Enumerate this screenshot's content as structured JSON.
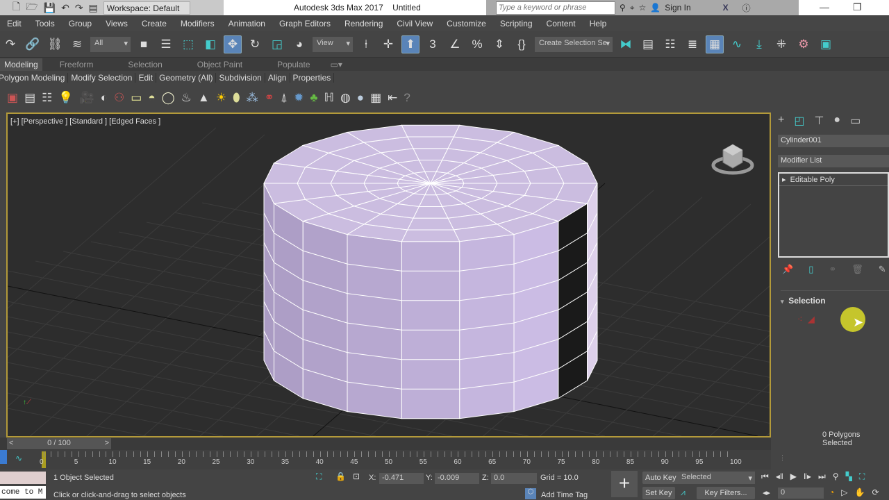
{
  "titlebar": {
    "workspace": "Workspace: Default",
    "app_title": "Autodesk 3ds Max 2017",
    "doc_title": "Untitled",
    "search_placeholder": "Type a keyword or phrase",
    "sign_in": "Sign In"
  },
  "menu": [
    "Edit",
    "Tools",
    "Group",
    "Views",
    "Create",
    "Modifiers",
    "Animation",
    "Graph Editors",
    "Rendering",
    "Civil View",
    "Customize",
    "Scripting",
    "Content",
    "Help"
  ],
  "toolbar": {
    "filter": "All",
    "ref_coord": "View",
    "selection_set": "Create Selection Se"
  },
  "ribbon": {
    "tabs": [
      "Modeling",
      "Freeform",
      "Selection",
      "Object Paint",
      "Populate"
    ],
    "panels": [
      "Polygon Modeling",
      "Modify Selection",
      "Edit",
      "Geometry (All)",
      "Subdivision",
      "Align",
      "Properties"
    ]
  },
  "viewport": {
    "label": "[+] [Perspective ] [Standard ] [Edged Faces ]"
  },
  "command_panel": {
    "object_name": "Cylinder001",
    "modifier_list": "Modifier List",
    "stack_item": "Editable Poly",
    "rollout": "Selection",
    "status": "0 Polygons Selected"
  },
  "timeline": {
    "frame": "0 / 100",
    "ticks": [
      "0",
      "5",
      "10",
      "15",
      "20",
      "25",
      "30",
      "35",
      "40",
      "45",
      "50",
      "55",
      "60",
      "65",
      "70",
      "75",
      "80",
      "85",
      "90",
      "95",
      "100"
    ]
  },
  "status": {
    "selected": "1 Object Selected",
    "prompt": "Click or click-and-drag to select objects",
    "listener": "come to M",
    "x_label": "X:",
    "x": "-0.471",
    "y_label": "Y:",
    "y": "-0.009",
    "z_label": "Z:",
    "z": "0.0",
    "grid": "Grid = 10.0",
    "add_time_tag": "Add Time Tag",
    "auto_key": "Auto Key",
    "set_key": "Set Key",
    "key_mode": "Selected",
    "key_filters": "Key Filters...",
    "current_frame": "0"
  },
  "colors": {
    "accent": "#5a84b8",
    "mesh": "#c8b8dc",
    "viewport_border": "#b39a3a"
  }
}
